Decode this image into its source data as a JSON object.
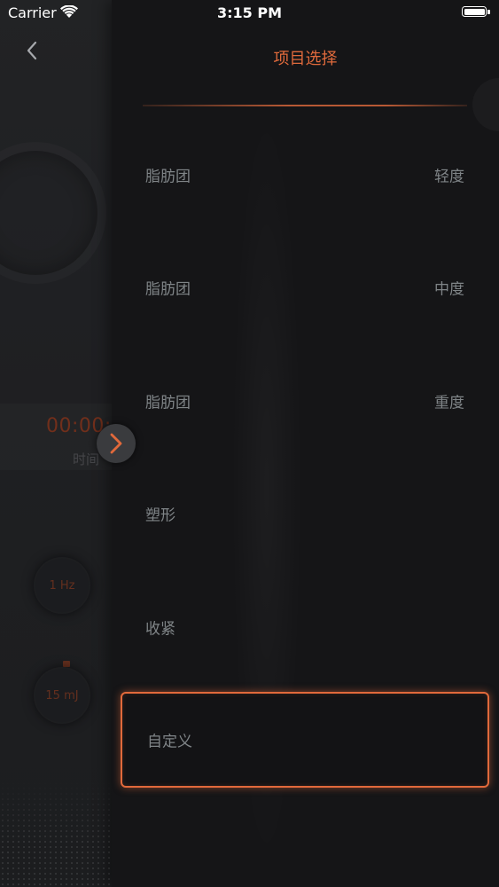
{
  "status_bar": {
    "carrier": "Carrier",
    "time": "3:15 PM",
    "wifi_icon": "wifi-icon",
    "battery_icon": "battery-full-icon"
  },
  "background_app": {
    "timer": "00:00:0",
    "timer_label": "时间",
    "frequency": "1 Hz",
    "energy": "15 mJ"
  },
  "drawer": {
    "title": "项目选择",
    "back_icon": "chevron-left-icon",
    "toggle_icon": "chevron-right-icon",
    "options": [
      {
        "name": "脂肪团",
        "level": "轻度",
        "selected": false
      },
      {
        "name": "脂肪团",
        "level": "中度",
        "selected": false
      },
      {
        "name": "脂肪团",
        "level": "重度",
        "selected": false
      },
      {
        "name": "塑形",
        "level": "",
        "selected": false
      },
      {
        "name": "收紧",
        "level": "",
        "selected": false
      },
      {
        "name": "自定义",
        "level": "",
        "selected": true
      }
    ]
  },
  "colors": {
    "accent": "#e1693b",
    "option_text": "#7f8487",
    "drawer_background": "#151517",
    "background_app": "#28292c"
  }
}
